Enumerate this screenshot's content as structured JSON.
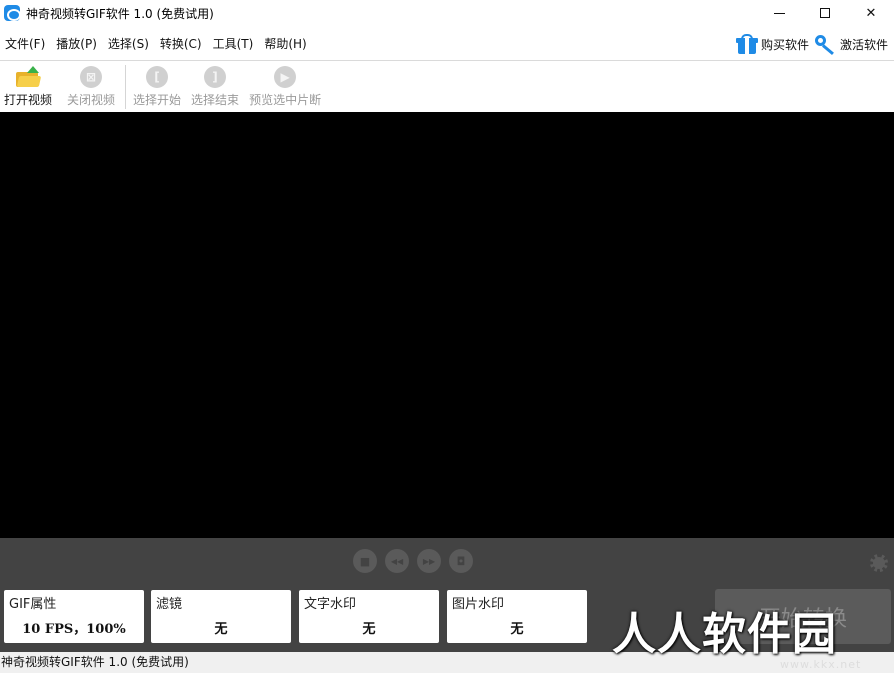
{
  "window": {
    "title": "神奇视频转GIF软件 1.0 (免费试用)",
    "controls": {
      "minimize": "",
      "maximize": "",
      "close": "✕"
    }
  },
  "menu": {
    "items": [
      {
        "label": "文件(F)"
      },
      {
        "label": "播放(P)"
      },
      {
        "label": "选择(S)"
      },
      {
        "label": "转换(C)"
      },
      {
        "label": "工具(T)"
      },
      {
        "label": "帮助(H)"
      }
    ],
    "buy_label": "购买软件",
    "activate_label": "激活软件"
  },
  "toolbar": {
    "open_video": "打开视频",
    "close_video": "关闭视频",
    "select_start": "选择开始",
    "select_end": "选择结束",
    "preview_clip": "预览选中片断",
    "close_glyph": "⊠",
    "start_glyph": "[",
    "end_glyph": "]",
    "preview_glyph": "▶"
  },
  "playback": {
    "stop_glyph": "■",
    "prev_glyph": "◀◀",
    "next_glyph": "▶▶",
    "snapshot_glyph": "◘"
  },
  "panels": [
    {
      "title": "GIF属性",
      "value": "10 FPS，100%"
    },
    {
      "title": "滤镜",
      "value": "无"
    },
    {
      "title": "文字水印",
      "value": "无"
    },
    {
      "title": "图片水印",
      "value": "无"
    }
  ],
  "convert_button": "开始转换",
  "watermark": {
    "text": "人人软件园",
    "url": "www.kkx.net"
  },
  "statusbar": {
    "text": "神奇视频转GIF软件 1.0 (免费试用)"
  },
  "colors": {
    "accent": "#1f8be6",
    "panel_bg": "#434343",
    "video_bg": "#000000"
  }
}
